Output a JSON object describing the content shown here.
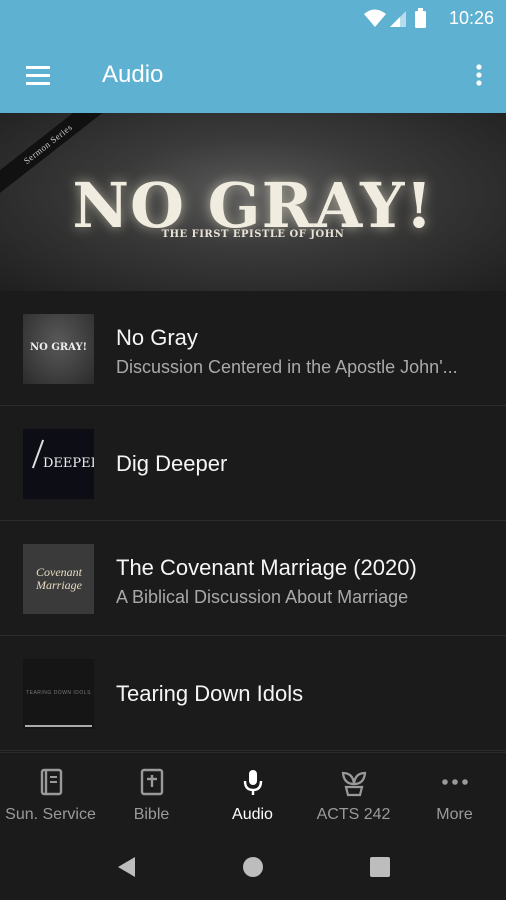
{
  "status_bar": {
    "time": "10:26"
  },
  "app_bar": {
    "title": "Audio"
  },
  "banner": {
    "ribbon_text": "Sermon Series",
    "title": "NO GRAY!",
    "subtitle": "THE FIRST EPISTLE OF JOHN"
  },
  "items": [
    {
      "title": "No Gray",
      "subtitle": "Discussion Centered in the Apostle John'...",
      "thumb_text": "NO GRAY!"
    },
    {
      "title": "Dig Deeper",
      "subtitle": "",
      "thumb_text": "DEEPER"
    },
    {
      "title": "The Covenant Marriage (2020)",
      "subtitle": "A Biblical Discussion About Marriage",
      "thumb_text": "Covenant Marriage"
    },
    {
      "title": "Tearing Down Idols",
      "subtitle": "",
      "thumb_text": "TEARING DOWN IDOLS"
    }
  ],
  "bottom_nav": [
    {
      "label": "Sun. Service",
      "icon": "book-icon"
    },
    {
      "label": "Bible",
      "icon": "bible-icon"
    },
    {
      "label": "Audio",
      "icon": "microphone-icon",
      "active": true
    },
    {
      "label": "ACTS 242",
      "icon": "sprout-icon"
    },
    {
      "label": "More",
      "icon": "more-dots-icon"
    }
  ],
  "colors": {
    "accent": "#5fb1d1",
    "background": "#1b1b1b",
    "secondary_text": "#a9a9a9"
  }
}
